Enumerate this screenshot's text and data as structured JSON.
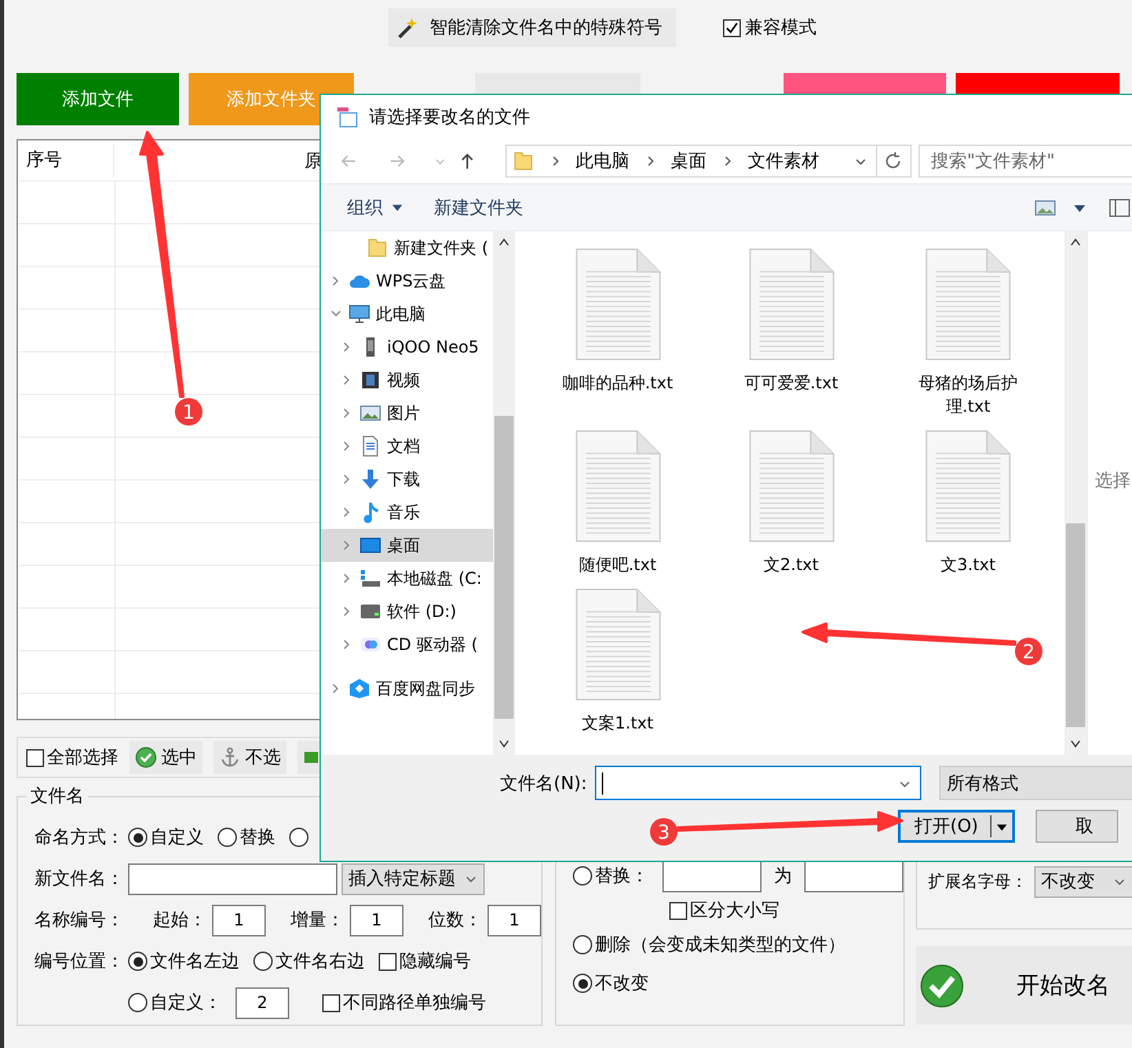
{
  "app": {
    "tool_button": "智能清除文件名中的特殊符号",
    "compat": {
      "label": "兼容模式",
      "checked": true
    },
    "toolbar": [
      {
        "kind": "labeled",
        "label": "添加文件",
        "color": "#008000"
      },
      {
        "kind": "labeled",
        "label": "添加文件夹",
        "color": "#f0981a"
      },
      {
        "kind": "covered",
        "color": "#e8e8e8"
      },
      {
        "kind": "covered",
        "color": "#ff5380"
      },
      {
        "kind": "covered",
        "color": "#ff0000"
      }
    ],
    "table": {
      "columns": [
        "序号",
        "原"
      ]
    },
    "select_bar": [
      {
        "kind": "checkbox",
        "label": "全部选择",
        "checked": false
      },
      {
        "kind": "check",
        "label": "选中"
      },
      {
        "kind": "anchor",
        "label": "不选"
      },
      {
        "kind": "partial"
      }
    ],
    "filename_group": {
      "title": "文件名",
      "naming": {
        "label": "命名方式：",
        "options": [
          {
            "label": "自定义",
            "selected": true
          },
          {
            "label": "替换",
            "selected": false
          },
          {
            "selected": false
          }
        ]
      },
      "new_name": {
        "label": "新文件名：",
        "insert": "插入特定标题"
      },
      "numbering": {
        "label": "名称编号：",
        "fields": [
          {
            "label": "起始：",
            "value": "1"
          },
          {
            "label": "增量：",
            "value": "1"
          },
          {
            "label": "位数：",
            "value": "1"
          }
        ]
      },
      "position": {
        "label": "编号位置：",
        "options": [
          {
            "label": "文件名左边",
            "selected": true
          },
          {
            "label": "文件名右边",
            "selected": false
          },
          {
            "label": "自定义：",
            "selected": false,
            "value": "2"
          }
        ],
        "checks": [
          {
            "label": "隐藏编号",
            "checked": false
          },
          {
            "label": "不同路径单独编号",
            "checked": false
          }
        ]
      }
    },
    "extension_group": {
      "replace": {
        "label": "替换：",
        "selected": false,
        "joiner": "为"
      },
      "case": {
        "label": "区分大小写",
        "checked": false
      },
      "delete": {
        "label": "删除（会变成未知类型的文件）",
        "selected": false
      },
      "keep": {
        "label": "不改变",
        "selected": true
      }
    },
    "ext_letters": {
      "label": "扩展名字母：",
      "value": "不改变"
    },
    "start_button": "开始改名"
  },
  "dialog": {
    "title": "请选择要改名的文件",
    "breadcrumb": [
      "此电脑",
      "桌面",
      "文件素材"
    ],
    "search": {
      "placeholder": "搜索\"文件素材\""
    },
    "commands": [
      "组织",
      "新建文件夹"
    ],
    "tree": [
      {
        "label": "新建文件夹 (",
        "kind": "folder",
        "selected": false
      },
      {
        "label": "WPS云盘",
        "kind": "cloud",
        "selected": false,
        "expanded": false
      },
      {
        "label": "此电脑",
        "kind": "computer",
        "selected": false,
        "expanded": true,
        "children": [
          {
            "label": "iQOO Neo5",
            "kind": "phone",
            "selected": false,
            "expanded": false
          },
          {
            "label": "视频",
            "kind": "video",
            "selected": false,
            "expanded": false
          },
          {
            "label": "图片",
            "kind": "picture",
            "selected": false,
            "expanded": false
          },
          {
            "label": "文档",
            "kind": "document",
            "selected": false,
            "expanded": false
          },
          {
            "label": "下载",
            "kind": "download",
            "selected": false,
            "expanded": false
          },
          {
            "label": "音乐",
            "kind": "music",
            "selected": false,
            "expanded": false
          },
          {
            "label": "桌面",
            "kind": "desktop",
            "selected": true,
            "expanded": false
          },
          {
            "label": "本地磁盘 (C:",
            "kind": "disk",
            "selected": false,
            "expanded": false
          },
          {
            "label": "软件 (D:)",
            "kind": "drive",
            "selected": false,
            "expanded": false
          },
          {
            "label": "CD 驱动器 (",
            "kind": "cd",
            "selected": false,
            "expanded": false
          }
        ]
      },
      {
        "label": "百度网盘同步",
        "kind": "netdisk",
        "selected": false,
        "expanded": false
      }
    ],
    "files": [
      "咖啡的品种.txt",
      "可可爱爱.txt",
      "母猪的场后护理.txt",
      "随便吧.txt",
      "文2.txt",
      "文3.txt",
      "文案1.txt"
    ],
    "preview_hint": "选择",
    "filename_label": "文件名(N):",
    "filter": "所有格式",
    "open_button": "打开(O)",
    "cancel_button": "取"
  },
  "annotations": [
    {
      "number": "1"
    },
    {
      "number": "2"
    },
    {
      "number": "3"
    }
  ]
}
